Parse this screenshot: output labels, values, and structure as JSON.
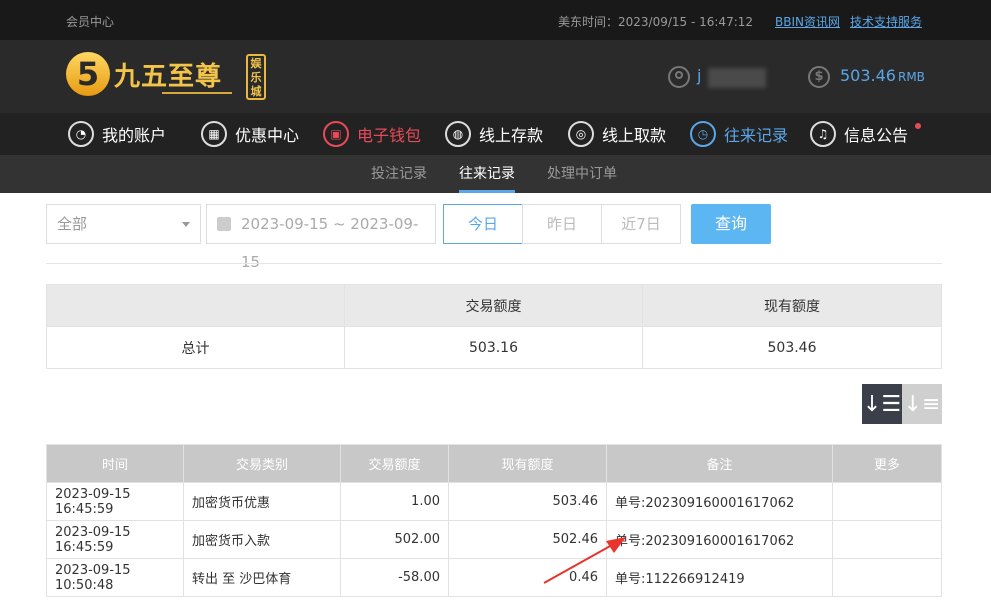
{
  "topbar": {
    "left": "会员中心",
    "time": "美东时间：2023/09/15 - 16:47:12",
    "link1": "BBIN资讯网",
    "link2": "技术支持服务"
  },
  "header": {
    "logo_num": "5",
    "logo_name": "九五至尊",
    "logo_badge": "娱乐城",
    "username": "j",
    "balance": "503.46",
    "balance_unit": "RMB"
  },
  "nav": [
    {
      "label": "我的账户",
      "icon": "user-icon",
      "state": "normal"
    },
    {
      "label": "优惠中心",
      "icon": "gift-icon",
      "state": "normal"
    },
    {
      "label": "电子钱包",
      "icon": "wallet-icon",
      "state": "red"
    },
    {
      "label": "线上存款",
      "icon": "deposit-icon",
      "state": "normal"
    },
    {
      "label": "线上取款",
      "icon": "withdraw-icon",
      "state": "normal"
    },
    {
      "label": "往来记录",
      "icon": "record-icon",
      "state": "blue"
    },
    {
      "label": "信息公告",
      "icon": "bell-icon",
      "state": "normal"
    }
  ],
  "subnav": [
    {
      "label": "投注记录"
    },
    {
      "label": "往来记录"
    },
    {
      "label": "处理中订单"
    }
  ],
  "filter": {
    "select": "全部",
    "date_range": "2023-09-15 ~ 2023-09-15",
    "segments": [
      "今日",
      "昨日",
      "近7日"
    ],
    "query": "查询"
  },
  "summary": {
    "headers": [
      "",
      "交易额度",
      "现有额度"
    ],
    "row": [
      "总计",
      "503.16",
      "503.46"
    ]
  },
  "records": {
    "headers": [
      "时间",
      "交易类别",
      "交易额度",
      "现有额度",
      "备注",
      "更多"
    ],
    "rows": [
      [
        "2023-09-15 16:45:59",
        "加密货币优惠",
        "1.00",
        "503.46",
        "单号:202309160001617062",
        ""
      ],
      [
        "2023-09-15 16:45:59",
        "加密货币入款",
        "502.00",
        "502.46",
        "单号:202309160001617062",
        ""
      ],
      [
        "2023-09-15 10:50:48",
        "转出 至 沙巴体育",
        "-58.00",
        "0.46",
        "单号:112266912419",
        ""
      ]
    ]
  },
  "colors": {
    "accent": "#5aa6e8",
    "red": "#e94a5a",
    "gold": "#f3c44a"
  }
}
